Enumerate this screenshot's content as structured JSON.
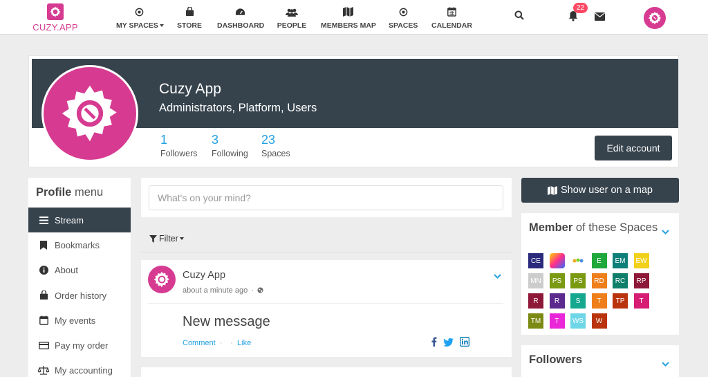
{
  "app": {
    "logo_text": "CUZY.APP",
    "brand_color": "#d63b91",
    "dark_color": "#36434d",
    "link_color": "#21a1e1"
  },
  "nav": {
    "items": [
      {
        "label": "MY SPACES",
        "icon": "dot-circle-icon"
      },
      {
        "label": "STORE",
        "icon": "bag-icon"
      },
      {
        "label": "DASHBOARD",
        "icon": "tachometer-icon"
      },
      {
        "label": "PEOPLE",
        "icon": "users-icon"
      },
      {
        "label": "MEMBERS MAP",
        "icon": "map-icon"
      },
      {
        "label": "SPACES",
        "icon": "dot-circle-icon"
      },
      {
        "label": "CALENDAR",
        "icon": "calendar-icon"
      }
    ],
    "notification_count": "22"
  },
  "profile": {
    "name": "Cuzy App",
    "groups": "Administrators, Platform, Users",
    "stats": [
      {
        "value": "1",
        "label": "Followers"
      },
      {
        "value": "3",
        "label": "Following"
      },
      {
        "value": "23",
        "label": "Spaces"
      }
    ],
    "edit_label": "Edit account"
  },
  "menu": {
    "title_bold": "Profile",
    "title_rest": " menu",
    "items": [
      {
        "label": "Stream",
        "icon": "list-icon",
        "active": true
      },
      {
        "label": "Bookmarks",
        "icon": "bookmark-icon"
      },
      {
        "label": "About",
        "icon": "info-icon"
      },
      {
        "label": "Order history",
        "icon": "shopping-bag-icon"
      },
      {
        "label": "My events",
        "icon": "calendar-icon"
      },
      {
        "label": "Pay my order",
        "icon": "credit-card-icon"
      },
      {
        "label": "My accounting",
        "icon": "balance-scale-icon"
      }
    ]
  },
  "stream": {
    "composer_placeholder": "What's on your mind?",
    "filter_label": "Filter",
    "entry": {
      "author": "Cuzy App",
      "time": "about a minute ago",
      "message": "New message",
      "comment_label": "Comment",
      "like_label": "Like"
    }
  },
  "sidebar": {
    "map_button": "Show user on a map",
    "spaces_title_bold": "Member",
    "spaces_title_rest": " of these Spaces",
    "spaces": [
      {
        "code": "CE",
        "color": "#2a2a7c"
      },
      {
        "code": "",
        "color": "logo-colorful"
      },
      {
        "code": "",
        "color": "logo-light"
      },
      {
        "code": "E",
        "color": "#1fa83b"
      },
      {
        "code": "EM",
        "color": "#0f7f7a"
      },
      {
        "code": "EW",
        "color": "#f1d11a"
      },
      {
        "code": "MN",
        "color": "#cccccc"
      },
      {
        "code": "PS",
        "color": "#7a9a12"
      },
      {
        "code": "PS",
        "color": "#7a9a12"
      },
      {
        "code": "RD",
        "color": "#ef7f1a"
      },
      {
        "code": "RC",
        "color": "#0f7f6a"
      },
      {
        "code": "RP",
        "color": "#8e1838"
      },
      {
        "code": "R",
        "color": "#8e1838"
      },
      {
        "code": "R",
        "color": "#5c2a8e"
      },
      {
        "code": "S",
        "color": "#16a88f"
      },
      {
        "code": "T",
        "color": "#ef7f1a"
      },
      {
        "code": "TP",
        "color": "#b9330d"
      },
      {
        "code": "T",
        "color": "#d61d73"
      },
      {
        "code": "TM",
        "color": "#7a8a12"
      },
      {
        "code": "T",
        "color": "#ea26d9"
      },
      {
        "code": "WS",
        "color": "#6fd6e8"
      },
      {
        "code": "W",
        "color": "#b9330d"
      }
    ],
    "followers_title": "Followers"
  }
}
